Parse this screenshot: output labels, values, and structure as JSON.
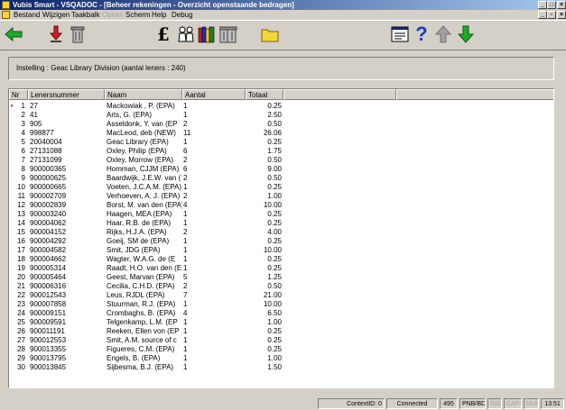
{
  "window": {
    "title": "Vubis Smart - VSQADOC - [Beheer rekeningen - Overzicht openstaande bedragen]"
  },
  "menu": {
    "items": [
      "Bestand",
      "Wijzigen",
      "Taakbalk",
      "Opties",
      "Scherm",
      "Help",
      "Debug"
    ],
    "disabled": [
      "Opties"
    ]
  },
  "toolbar": {
    "buttons": [
      {
        "name": "back-icon"
      },
      {
        "name": "red-down-arrow-icon"
      },
      {
        "name": "trash-icon"
      },
      {
        "name": "pound-icon"
      },
      {
        "name": "users-icon"
      },
      {
        "name": "books-icon"
      },
      {
        "name": "trash-multiple-icon"
      },
      {
        "name": "folder-icon"
      },
      {
        "name": "form-icon"
      },
      {
        "name": "help-icon"
      },
      {
        "name": "up-arrow-icon"
      },
      {
        "name": "down-arrow-icon"
      }
    ],
    "pound_glyph": "£",
    "help_glyph": "?"
  },
  "info": {
    "text": "Instelling : Geac Library Division (aantal leners : 240)"
  },
  "table": {
    "columns": [
      "Nr",
      "Lenersnummer",
      "Naam",
      "Aantal",
      "Totaal"
    ],
    "current_row_marker": "♦",
    "rows": [
      [
        "1",
        "27",
        "Mackowiak , P. (EPA)",
        "1",
        "0.25"
      ],
      [
        "2",
        "41",
        "Arts, G. (EPA)",
        "1",
        "2.50"
      ],
      [
        "3",
        "905",
        "Asseldonk, Y. van (EP",
        "2",
        "0.50"
      ],
      [
        "4",
        "998877",
        "MacLeod, deb (NEW)",
        "11",
        "26.06"
      ],
      [
        "5",
        "20040004",
        "Geac Library (EPA)",
        "1",
        "0.25"
      ],
      [
        "6",
        "27131088",
        "Oxley, Philip (EPA)",
        "6",
        "1.75"
      ],
      [
        "7",
        "27131099",
        "Oxley, Morrow (EPA)",
        "2",
        "0.50"
      ],
      [
        "8",
        "900000365",
        "Homman, CJJM (EPA)",
        "6",
        "9.00"
      ],
      [
        "9",
        "900000625",
        "Baardwijk, J.E.W. van (",
        "2",
        "0.50"
      ],
      [
        "10",
        "900000665",
        "Voeten, J.C.A.M. (EPA)",
        "1",
        "0.25"
      ],
      [
        "11",
        "900002709",
        "Verhoeven, A. J. (EPA)",
        "2",
        "1.00"
      ],
      [
        "12",
        "900002839",
        "Borst, M. van den (EPA)",
        "4",
        "10.00"
      ],
      [
        "13",
        "900003240",
        "Haagen, MEA (EPA)",
        "1",
        "0.25"
      ],
      [
        "14",
        "900004062",
        "Haar, R.B. de (EPA)",
        "1",
        "0.25"
      ],
      [
        "15",
        "900004152",
        "Rijks, H.J.A. (EPA)",
        "2",
        "4.00"
      ],
      [
        "16",
        "900004292",
        "Goeij, SM de (EPA)",
        "1",
        "0.25"
      ],
      [
        "17",
        "900004582",
        "Smit, JDG (EPA)",
        "1",
        "10.00"
      ],
      [
        "18",
        "900004662",
        "Wagter, W.A.G. de (E",
        "1",
        "0.25"
      ],
      [
        "19",
        "900005314",
        "Raadt, H.O. van den (E",
        "1",
        "0.25"
      ],
      [
        "20",
        "900005464",
        "Geest, Marvan (EPA)",
        "5",
        "1.25"
      ],
      [
        "21",
        "900006316",
        "Cecilia, C.H.D. (EPA)",
        "2",
        "0.50"
      ],
      [
        "22",
        "900012543",
        "Leus, RJDL (EPA)",
        "7",
        "21.00"
      ],
      [
        "23",
        "900007858",
        "Stuurman, R.J. (EPA)",
        "1",
        "10.00"
      ],
      [
        "24",
        "900009151",
        "Crombaghs, B. (EPA)",
        "4",
        "6.50"
      ],
      [
        "25",
        "900009591",
        "Telgenkamp, L.M. (EP",
        "1",
        "1.00"
      ],
      [
        "26",
        "900011191",
        "Reeken, Ellen von (EP",
        "1",
        "0.25"
      ],
      [
        "27",
        "900012553",
        "Smit, A.M. source of c",
        "1",
        "0.25"
      ],
      [
        "28",
        "900013355",
        "Figueres, C.M. (EPA)",
        "1",
        "0.25"
      ],
      [
        "29",
        "900013795",
        "Engels, B. (EPA)",
        "1",
        "1.00"
      ],
      [
        "30",
        "900013845",
        "Sijbesma, B.J. (EPA)",
        "1",
        "1.50"
      ]
    ]
  },
  "status": {
    "context": "ContextID: 0",
    "connection": "Connected",
    "code": "495",
    "keyboard": "PNB/BD",
    "ins": "INS",
    "caps": "CAPS",
    "num": "NUM",
    "time": "13:51"
  }
}
